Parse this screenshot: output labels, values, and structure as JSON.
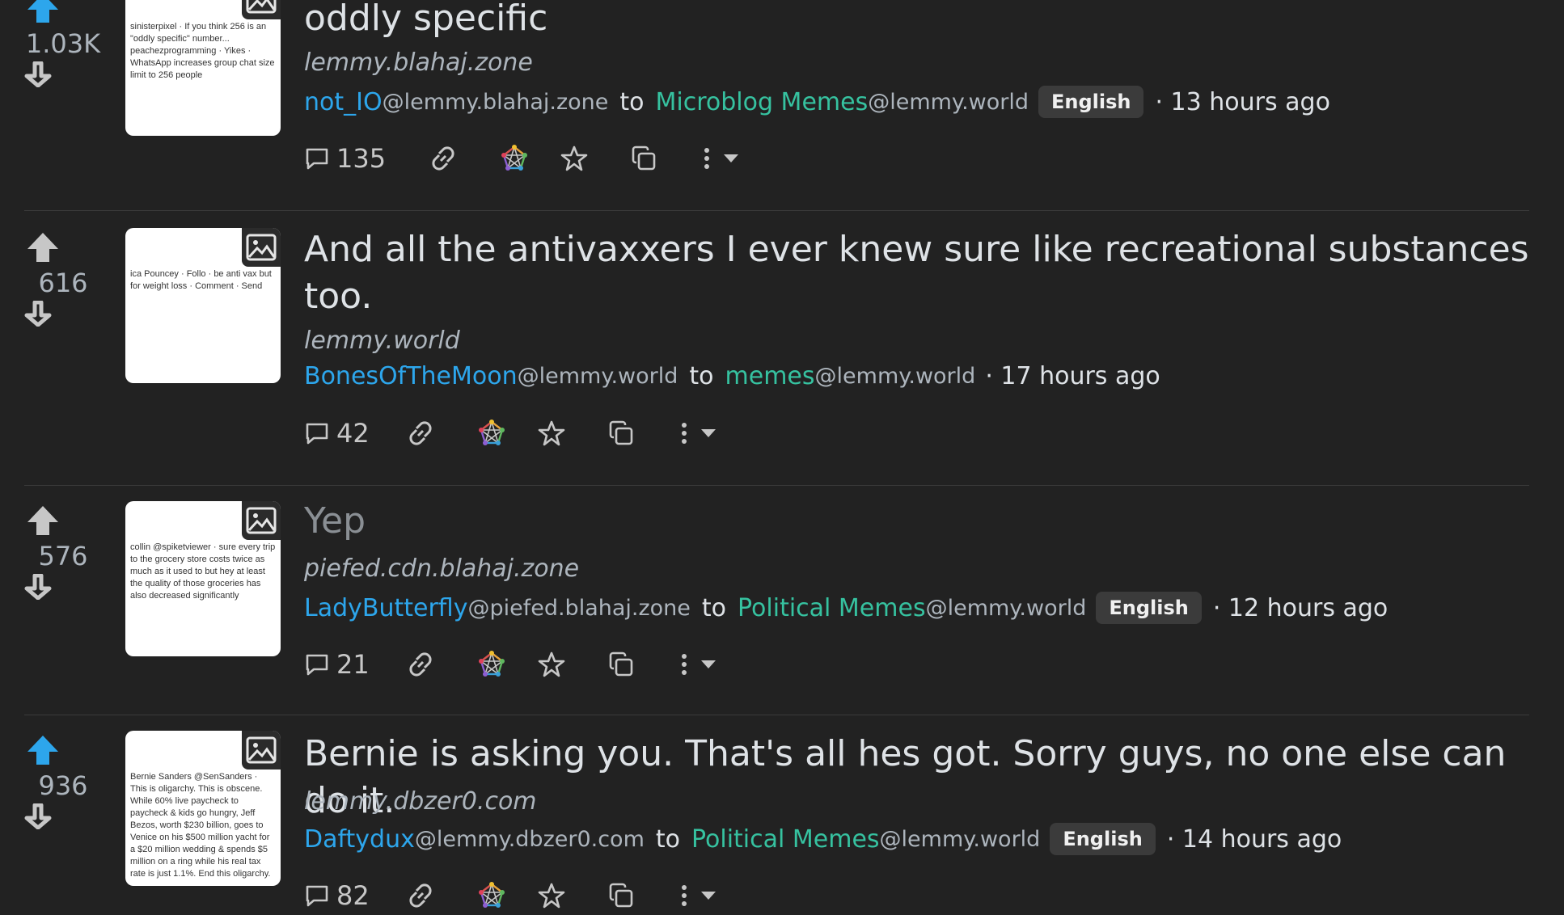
{
  "posts": [
    {
      "score": "1.03K",
      "title": "oddly specific",
      "domain": "lemmy.blahaj.zone",
      "user": "not_IO",
      "user_instance": "@lemmy.blahaj.zone",
      "to": "to",
      "community": "Microblog Memes",
      "community_instance": "@lemmy.world",
      "language": "English",
      "age": "· 13 hours ago",
      "comments": "135",
      "upvoted": true,
      "read": false,
      "thumb_text": "sinisterpixel · If you think 256 is an \"oddly specific\" number... peachezprogramming · Yikes · WhatsApp increases group chat size limit to 256 people"
    },
    {
      "score": "616",
      "title": "And all the antivaxxers I ever knew sure like recreational substances too.",
      "domain": "lemmy.world",
      "user": "BonesOfTheMoon",
      "user_instance": "@lemmy.world",
      "to": "to",
      "community": "memes",
      "community_instance": "@lemmy.world",
      "language": "",
      "age": "· 17 hours ago",
      "comments": "42",
      "upvoted": false,
      "read": false,
      "thumb_text": "ica Pouncey · Follo · be anti vax but for weight loss · Comment · Send"
    },
    {
      "score": "576",
      "title": "Yep",
      "domain": "piefed.cdn.blahaj.zone",
      "user": "LadyButterfly",
      "user_instance": "@piefed.blahaj.zone",
      "to": "to",
      "community": "Political Memes",
      "community_instance": "@lemmy.world",
      "language": "English",
      "age": "· 12 hours ago",
      "comments": "21",
      "upvoted": false,
      "read": true,
      "thumb_text": "collin @spiketviewer · sure every trip to the grocery store costs twice as much as it used to but hey at least the quality of those groceries has also decreased significantly"
    },
    {
      "score": "936",
      "title": "Bernie is asking you. That's all hes got. Sorry guys, no one else can do it.",
      "domain": "lemmy.dbzer0.com",
      "user": "Daftydux",
      "user_instance": "@lemmy.dbzer0.com",
      "to": "to",
      "community": "Political Memes",
      "community_instance": "@lemmy.world",
      "language": "English",
      "age": "· 14 hours ago",
      "comments": "82",
      "upvoted": true,
      "read": false,
      "thumb_text": "Bernie Sanders @SenSanders · This is oligarchy. This is obscene. While 60% live paycheck to paycheck & kids go hungry, Jeff Bezos, worth $230 billion, goes to Venice on his $500 million yacht for a $20 million wedding & spends $5 million on a ring while his real tax rate is just 1.1%. End this oligarchy."
    }
  ],
  "colors": {
    "upvote_active": "#2da6ec",
    "vote_inactive": "#c7c7c7",
    "user": "#2da6ec",
    "community": "#36c2a0"
  },
  "icons": [
    "arrow-up-icon",
    "arrow-down-icon",
    "image-icon",
    "comment-icon",
    "link-icon",
    "fediverse-icon",
    "star-icon",
    "copy-icon",
    "more-vertical-icon",
    "caret-down-icon"
  ]
}
